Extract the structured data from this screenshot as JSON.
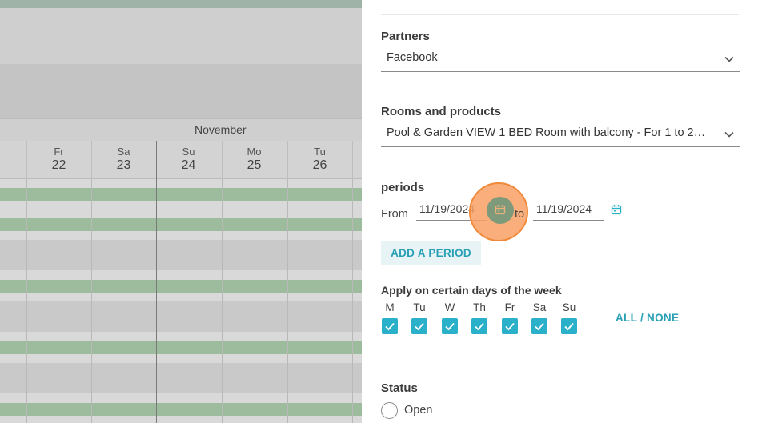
{
  "calendar": {
    "month": "November",
    "days": [
      {
        "name": "Fr",
        "date": "22"
      },
      {
        "name": "Sa",
        "date": "23"
      },
      {
        "name": "Su",
        "date": "24"
      },
      {
        "name": "Mo",
        "date": "25"
      },
      {
        "name": "Tu",
        "date": "26"
      }
    ]
  },
  "form": {
    "partners": {
      "label": "Partners",
      "value": "Facebook"
    },
    "rooms": {
      "label": "Rooms and products",
      "value": "Pool & Garden VIEW 1 BED Room with balcony - For 1 to 2 pe…"
    },
    "periods": {
      "label": "periods",
      "from_label": "From",
      "from_value": "11/19/2024",
      "to_label": "to",
      "to_value": "11/19/2024",
      "add_label": "ADD A PERIOD"
    },
    "weekdays": {
      "label": "Apply on certain days of the week",
      "days": [
        "M",
        "Tu",
        "W",
        "Th",
        "Fr",
        "Sa",
        "Su"
      ],
      "all_none": "ALL / NONE"
    },
    "status": {
      "label": "Status",
      "open_label": "Open"
    }
  },
  "colors": {
    "accent": "#2ab0c8",
    "highlight": "#f8a064"
  }
}
